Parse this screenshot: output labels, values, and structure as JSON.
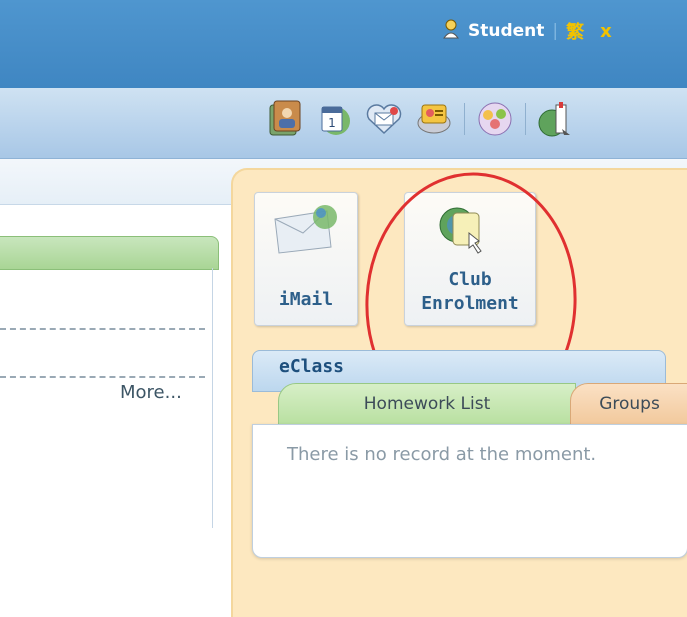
{
  "header": {
    "user_label": "Student",
    "separator": "|",
    "language_label": "繁",
    "close_label": "x",
    "accent_color": "#f2c200",
    "bar_color": "#4a90cc"
  },
  "toolbar": {
    "icons": [
      {
        "name": "profile-album-icon"
      },
      {
        "name": "calendar-icon"
      },
      {
        "name": "email-heart-icon"
      },
      {
        "name": "news-icon"
      },
      {
        "name": "groups-icon"
      },
      {
        "name": "school-globe-icon"
      }
    ]
  },
  "main": {
    "more_label": "More..."
  },
  "apps": {
    "imail_label": "iMail",
    "club_line1": "Club",
    "club_line2": "Enrolment"
  },
  "eclass": {
    "title": "eClass",
    "tabs": [
      {
        "label": "Homework List"
      },
      {
        "label": "Groups"
      }
    ],
    "empty_message": "There is no record at the moment."
  },
  "annotation": {
    "color": "#e03030"
  }
}
